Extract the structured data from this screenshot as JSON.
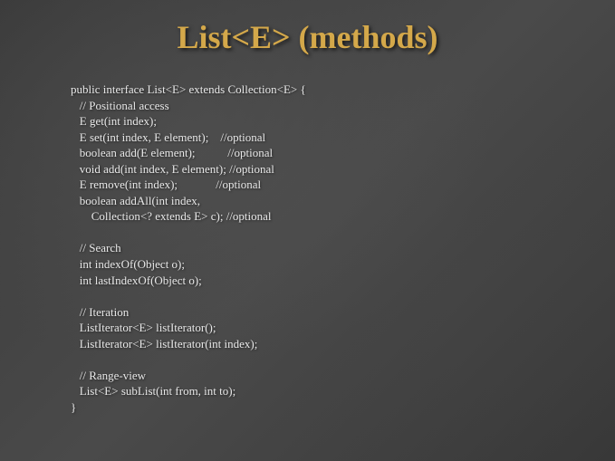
{
  "title": "List<E> (methods)",
  "code": "public interface List<E> extends Collection<E> {\n   // Positional access\n   E get(int index);\n   E set(int index, E element);    //optional\n   boolean add(E element);           //optional\n   void add(int index, E element); //optional\n   E remove(int index);             //optional\n   boolean addAll(int index,\n       Collection<? extends E> c); //optional\n\n   // Search\n   int indexOf(Object o);\n   int lastIndexOf(Object o);\n\n   // Iteration\n   ListIterator<E> listIterator();\n   ListIterator<E> listIterator(int index);\n\n   // Range-view\n   List<E> subList(int from, int to);\n}"
}
